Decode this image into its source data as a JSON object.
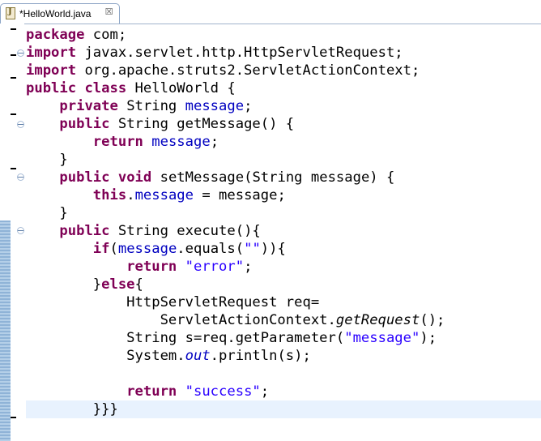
{
  "tab": {
    "icon": "java-file-icon",
    "label": "*HelloWorld.java",
    "close": "☒"
  },
  "colors": {
    "keyword": "#7f0055",
    "field": "#0000c0",
    "string": "#2a00ff",
    "current_line": "#e8f2fe"
  },
  "code": {
    "l1": {
      "kw": "package",
      "rest": " com;"
    },
    "l2": {
      "kw": "import",
      "rest": " javax.servlet.http.HttpServletRequest;"
    },
    "l3": {
      "kw": "import",
      "rest": " org.apache.struts2.ServletActionContext;"
    },
    "l4": {
      "kw1": "public",
      "kw2": "class",
      "rest": " HelloWorld {"
    },
    "l5": {
      "indent": "    ",
      "kw": "private",
      "mid": " String ",
      "fld": "message",
      "end": ";"
    },
    "l6": {
      "indent": "    ",
      "kw": "public",
      "rest": " String getMessage() {"
    },
    "l7": {
      "indent": "        ",
      "kw": "return",
      "sp": " ",
      "fld": "message",
      "end": ";"
    },
    "l8": {
      "text": "    }"
    },
    "l9": {
      "indent": "    ",
      "kw1": "public",
      "kw2": "void",
      "rest": " setMessage(String message) {"
    },
    "l10": {
      "indent": "        ",
      "kw": "this",
      "dot": ".",
      "fld": "message",
      "end": " = message;"
    },
    "l11": {
      "text": "    }"
    },
    "l12": {
      "indent": "    ",
      "kw": "public",
      "rest": " String execute(){"
    },
    "l13": {
      "indent": "        ",
      "kw": "if",
      "open": "(",
      "fld": "message",
      "mid": ".equals(",
      "str": "\"\"",
      "end": ")){"
    },
    "l14": {
      "indent": "            ",
      "kw": "return",
      "sp": " ",
      "str": "\"error\"",
      "end": ";"
    },
    "l15": {
      "indent": "        }",
      "kw": "else",
      "end": "{"
    },
    "l16": {
      "text": "            HttpServletRequest req="
    },
    "l17": {
      "indent": "                ServletActionContext.",
      "itl": "getRequest",
      "end": "();"
    },
    "l18": {
      "indent": "            String s=req.getParameter(",
      "str": "\"message\"",
      "end": ");"
    },
    "l19": {
      "indent": "            System.",
      "stat": "out",
      "end": ".println(s);"
    },
    "l20": {
      "text": ""
    },
    "l21": {
      "indent": "            ",
      "kw": "return",
      "sp": " ",
      "str": "\"success\"",
      "end": ";"
    },
    "l22": {
      "text": "        }}}"
    }
  }
}
